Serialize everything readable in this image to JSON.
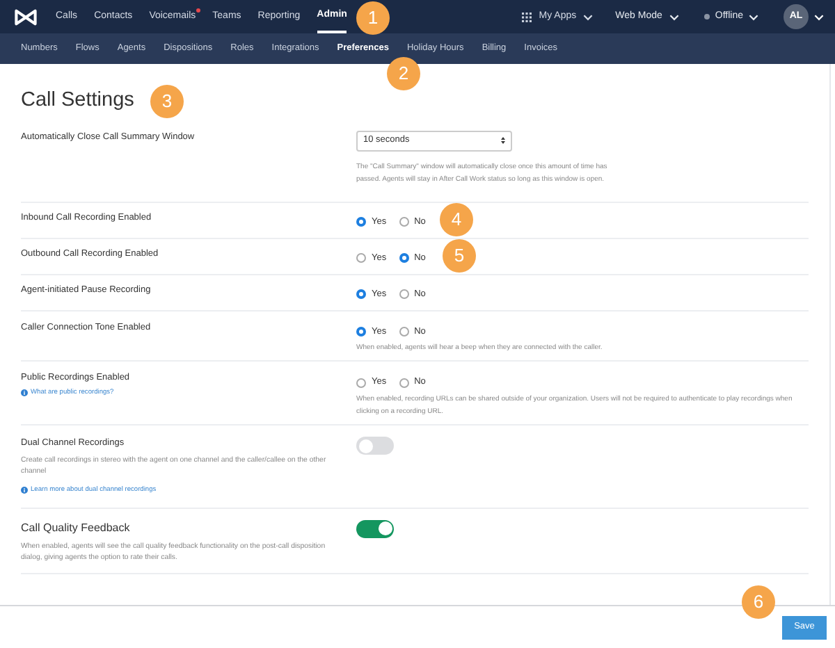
{
  "nav": {
    "items": [
      {
        "label": "Calls",
        "selected": false,
        "badge": false
      },
      {
        "label": "Contacts",
        "selected": false,
        "badge": false
      },
      {
        "label": "Voicemails",
        "selected": false,
        "badge": true
      },
      {
        "label": "Teams",
        "selected": false,
        "badge": false
      },
      {
        "label": "Reporting",
        "selected": false,
        "badge": false
      },
      {
        "label": "Admin",
        "selected": true,
        "badge": false
      }
    ],
    "my_apps": "My Apps",
    "mode": "Web Mode",
    "status": "Offline",
    "avatar": "AL"
  },
  "subnav": [
    {
      "label": "Numbers",
      "selected": false
    },
    {
      "label": "Flows",
      "selected": false
    },
    {
      "label": "Agents",
      "selected": false
    },
    {
      "label": "Dispositions",
      "selected": false
    },
    {
      "label": "Roles",
      "selected": false
    },
    {
      "label": "Integrations",
      "selected": false
    },
    {
      "label": "Preferences",
      "selected": true
    },
    {
      "label": "Holiday Hours",
      "selected": false
    },
    {
      "label": "Billing",
      "selected": false
    },
    {
      "label": "Invoices",
      "selected": false
    }
  ],
  "title": "Call Settings",
  "settings": [
    {
      "kind": "select",
      "label": "Automatically Close Call Summary Window",
      "value": "10 seconds",
      "help": "The \"Call Summary\" window will automatically close once this amount of time has passed. Agents will stay in After Call Work status so long as this window is open."
    },
    {
      "kind": "radio",
      "label": "Inbound Call Recording Enabled",
      "options": [
        {
          "label": "Yes",
          "selected": true
        },
        {
          "label": "No",
          "selected": false
        }
      ]
    },
    {
      "kind": "radio",
      "label": "Outbound Call Recording Enabled",
      "options": [
        {
          "label": "Yes",
          "selected": false
        },
        {
          "label": "No",
          "selected": true
        }
      ]
    },
    {
      "kind": "radio",
      "label": "Agent-initiated Pause Recording",
      "options": [
        {
          "label": "Yes",
          "selected": true
        },
        {
          "label": "No",
          "selected": false
        }
      ]
    },
    {
      "kind": "radio",
      "label": "Caller Connection Tone Enabled",
      "options": [
        {
          "label": "Yes",
          "selected": true
        },
        {
          "label": "No",
          "selected": false
        }
      ],
      "help": "When enabled, agents will hear a beep when they are connected with the caller."
    },
    {
      "kind": "radio",
      "label": "Public Recordings Enabled",
      "link": "What are public recordings?",
      "options": [
        {
          "label": "Yes",
          "selected": false
        },
        {
          "label": "No",
          "selected": false
        }
      ],
      "help": "When enabled, recording URLs can be shared outside of your organization. Users will not be required to authenticate to play recordings when clicking on a recording URL."
    },
    {
      "kind": "toggle",
      "label": "Dual Channel Recordings",
      "on": false,
      "description": "Create call recordings in stereo with the agent on one channel and the caller/callee on the other channel",
      "link": "Learn more about dual channel recordings"
    },
    {
      "kind": "toggle",
      "label": "Call Quality Feedback",
      "on": true,
      "description": "When enabled, agents will see the call quality feedback functionality on the post-call disposition dialog, giving agents the option to rate their calls."
    }
  ],
  "save": "Save",
  "callouts": [
    "1",
    "2",
    "3",
    "4",
    "5",
    "6"
  ]
}
